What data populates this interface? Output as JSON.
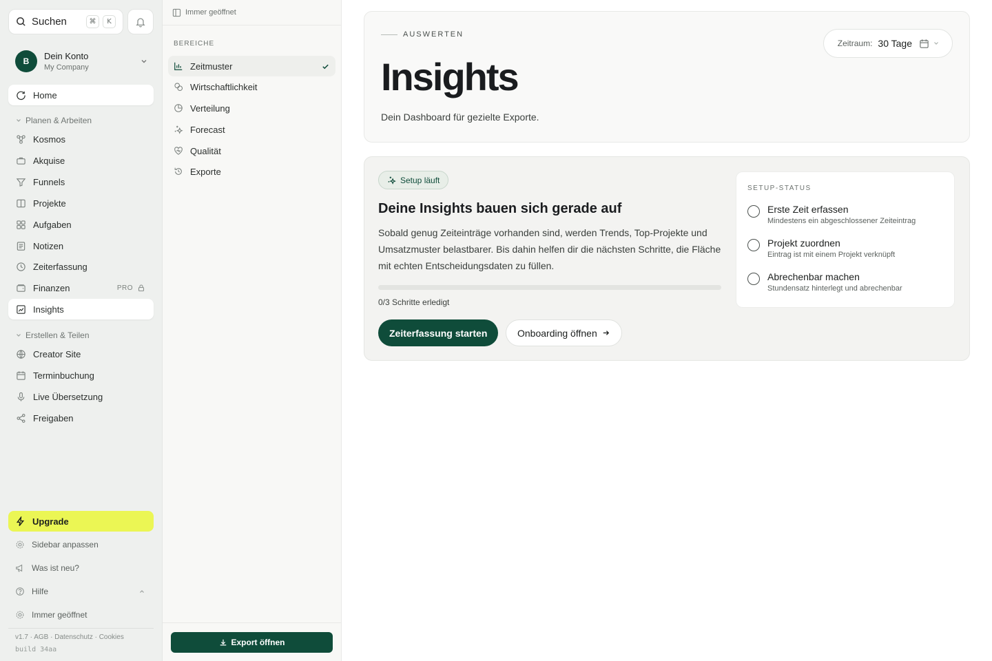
{
  "sidebar": {
    "search": {
      "label": "Suchen",
      "kbd": [
        "⌘",
        "K"
      ]
    },
    "account": {
      "initial": "B",
      "name": "Dein Konto",
      "company": "My Company"
    },
    "home": "Home",
    "group1": "Planen & Arbeiten",
    "group1_items": [
      "Kosmos",
      "Akquise",
      "Funnels",
      "Projekte",
      "Aufgaben",
      "Notizen",
      "Zeiterfassung",
      "Finanzen",
      "Insights"
    ],
    "pro_tag": "PRO",
    "group2": "Erstellen & Teilen",
    "group2_items": [
      "Creator Site",
      "Terminbuchung",
      "Live Übersetzung",
      "Freigaben"
    ],
    "upgrade": "Upgrade",
    "footer": [
      "Sidebar anpassen",
      "Was ist neu?",
      "Hilfe",
      "Immer geöffnet"
    ],
    "legal": "v1.7 · AGB · Datenschutz · Cookies",
    "build": "build 34aa"
  },
  "subpanel": {
    "top": "Immer geöffnet",
    "heading": "BEREICHE",
    "items": [
      "Zeitmuster",
      "Wirtschaftlichkeit",
      "Verteilung",
      "Forecast",
      "Qualität",
      "Exporte"
    ],
    "export_button": "Export öffnen"
  },
  "hero": {
    "eyebrow": "AUSWERTEN",
    "title": "Insights",
    "subtitle": "Dein Dashboard für gezielte Exporte.",
    "range_label": "Zeitraum:",
    "range_value": "30 Tage"
  },
  "setup": {
    "badge": "Setup läuft",
    "title": "Deine Insights bauen sich gerade auf",
    "text": "Sobald genug Zeiteinträge vorhanden sind, werden Trends, Top-Projekte und Umsatzmuster belastbarer. Bis dahin helfen dir die nächsten Schritte, die Fläche mit echten Entscheidungsdaten zu füllen.",
    "progress": 0,
    "steps_done": "0/3 Schritte erledigt",
    "primary_button": "Zeiterfassung starten",
    "secondary_button": "Onboarding öffnen",
    "status_heading": "SETUP-STATUS",
    "status_items": [
      {
        "title": "Erste Zeit erfassen",
        "desc": "Mindestens ein abgeschlossener Zeiteintrag"
      },
      {
        "title": "Projekt zuordnen",
        "desc": "Eintrag ist mit einem Projekt verknüpft"
      },
      {
        "title": "Abrechenbar machen",
        "desc": "Stundensatz hinterlegt und abrechenbar"
      }
    ]
  },
  "colors": {
    "brand": "#0f4c3a",
    "upgrade": "#ebf654",
    "sidebar_bg": "#eef0ee"
  }
}
